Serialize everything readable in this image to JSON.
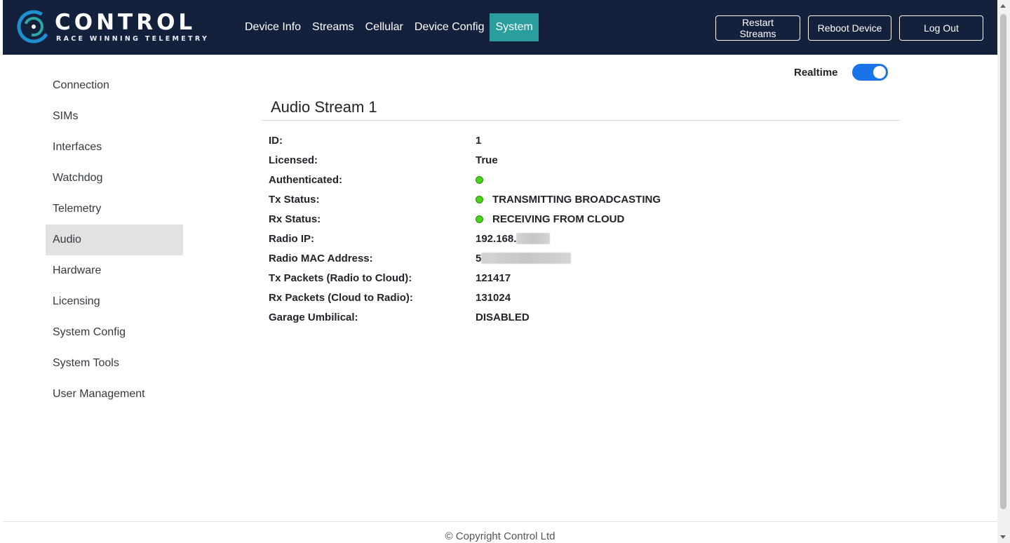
{
  "brand": {
    "name": "CONTROL",
    "tagline": "RACE WINNING TELEMETRY"
  },
  "nav": {
    "links": [
      "Device Info",
      "Streams",
      "Cellular",
      "Device Config",
      "System"
    ],
    "active": "System",
    "restart_label": "Restart Streams",
    "reboot_label": "Reboot Device",
    "logout_label": "Log Out"
  },
  "sidebar": {
    "items": [
      "Connection",
      "SIMs",
      "Interfaces",
      "Watchdog",
      "Telemetry",
      "Audio",
      "Hardware",
      "Licensing",
      "System Config",
      "System Tools",
      "User Management"
    ],
    "active": "Audio"
  },
  "realtime": {
    "label": "Realtime",
    "on": true
  },
  "panel": {
    "title": "Audio Stream 1",
    "rows": {
      "id": {
        "label": "ID:",
        "value": "1"
      },
      "licensed": {
        "label": "Licensed:",
        "value": "True"
      },
      "authenticated": {
        "label": "Authenticated:",
        "status": "green"
      },
      "tx_status": {
        "label": "Tx Status:",
        "status": "green",
        "value": "TRANSMITTING BROADCASTING"
      },
      "rx_status": {
        "label": "Rx Status:",
        "status": "green",
        "value": "RECEIVING FROM CLOUD"
      },
      "radio_ip": {
        "label": "Radio IP:",
        "value": "192.168."
      },
      "radio_mac": {
        "label": "Radio MAC Address:",
        "value": "5"
      },
      "tx_packets": {
        "label": "Tx Packets (Radio to Cloud):",
        "value": "121417"
      },
      "rx_packets": {
        "label": "Rx Packets (Cloud to Radio):",
        "value": "131024"
      },
      "garage_umbilical": {
        "label": "Garage Umbilical:",
        "value": "DISABLED"
      }
    }
  },
  "colors": {
    "navbar": "#14213d",
    "active_nav": "#2a9d9d",
    "status_green": "#4cd419",
    "toggle_on": "#1a73e8"
  },
  "footer": {
    "text": "© Copyright Control Ltd"
  }
}
